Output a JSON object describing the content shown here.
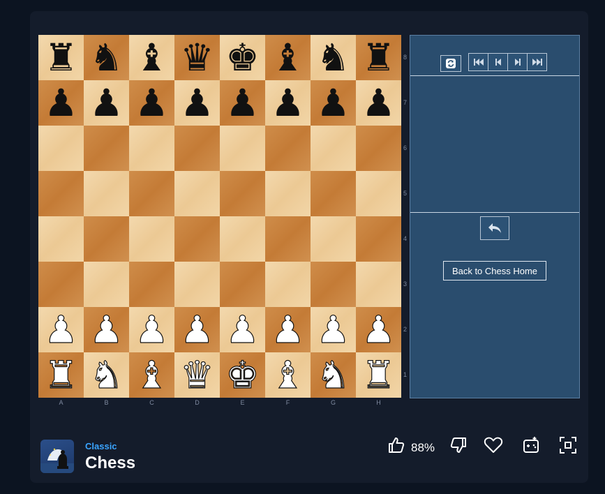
{
  "board": {
    "rows": [
      [
        {
          "p": "♜",
          "c": "black"
        },
        {
          "p": "♞",
          "c": "black"
        },
        {
          "p": "♝",
          "c": "black"
        },
        {
          "p": "♛",
          "c": "black"
        },
        {
          "p": "♚",
          "c": "black"
        },
        {
          "p": "♝",
          "c": "black"
        },
        {
          "p": "♞",
          "c": "black"
        },
        {
          "p": "♜",
          "c": "black"
        }
      ],
      [
        {
          "p": "♟",
          "c": "black"
        },
        {
          "p": "♟",
          "c": "black"
        },
        {
          "p": "♟",
          "c": "black"
        },
        {
          "p": "♟",
          "c": "black"
        },
        {
          "p": "♟",
          "c": "black"
        },
        {
          "p": "♟",
          "c": "black"
        },
        {
          "p": "♟",
          "c": "black"
        },
        {
          "p": "♟",
          "c": "black"
        }
      ],
      [
        {
          "p": "",
          "c": ""
        },
        {
          "p": "",
          "c": ""
        },
        {
          "p": "",
          "c": ""
        },
        {
          "p": "",
          "c": ""
        },
        {
          "p": "",
          "c": ""
        },
        {
          "p": "",
          "c": ""
        },
        {
          "p": "",
          "c": ""
        },
        {
          "p": "",
          "c": ""
        }
      ],
      [
        {
          "p": "",
          "c": ""
        },
        {
          "p": "",
          "c": ""
        },
        {
          "p": "",
          "c": ""
        },
        {
          "p": "",
          "c": ""
        },
        {
          "p": "",
          "c": ""
        },
        {
          "p": "",
          "c": ""
        },
        {
          "p": "",
          "c": ""
        },
        {
          "p": "",
          "c": ""
        }
      ],
      [
        {
          "p": "",
          "c": ""
        },
        {
          "p": "",
          "c": ""
        },
        {
          "p": "",
          "c": ""
        },
        {
          "p": "",
          "c": ""
        },
        {
          "p": "",
          "c": ""
        },
        {
          "p": "",
          "c": ""
        },
        {
          "p": "",
          "c": ""
        },
        {
          "p": "",
          "c": ""
        }
      ],
      [
        {
          "p": "",
          "c": ""
        },
        {
          "p": "",
          "c": ""
        },
        {
          "p": "",
          "c": ""
        },
        {
          "p": "",
          "c": ""
        },
        {
          "p": "",
          "c": ""
        },
        {
          "p": "",
          "c": ""
        },
        {
          "p": "",
          "c": ""
        },
        {
          "p": "",
          "c": ""
        }
      ],
      [
        {
          "p": "♟",
          "c": "white"
        },
        {
          "p": "♟",
          "c": "white"
        },
        {
          "p": "♟",
          "c": "white"
        },
        {
          "p": "♟",
          "c": "white"
        },
        {
          "p": "♟",
          "c": "white"
        },
        {
          "p": "♟",
          "c": "white"
        },
        {
          "p": "♟",
          "c": "white"
        },
        {
          "p": "♟",
          "c": "white"
        }
      ],
      [
        {
          "p": "♜",
          "c": "white"
        },
        {
          "p": "♞",
          "c": "white"
        },
        {
          "p": "♝",
          "c": "white"
        },
        {
          "p": "♛",
          "c": "white"
        },
        {
          "p": "♚",
          "c": "white"
        },
        {
          "p": "♝",
          "c": "white"
        },
        {
          "p": "♞",
          "c": "white"
        },
        {
          "p": "♜",
          "c": "white"
        }
      ]
    ],
    "ranks": [
      "8",
      "7",
      "6",
      "5",
      "4",
      "3",
      "2",
      "1"
    ],
    "files": [
      "A",
      "B",
      "C",
      "D",
      "E",
      "F",
      "G",
      "H"
    ]
  },
  "panel": {
    "flip_icon": "flip-board-icon",
    "nav_icons": [
      "first-move-icon",
      "prev-move-icon",
      "next-move-icon",
      "last-move-icon"
    ],
    "undo_icon": "undo-icon",
    "home_label": "Back to Chess Home"
  },
  "footer": {
    "category": "Classic",
    "title": "Chess",
    "like_pct": "88%",
    "icons": [
      "thumbs-up-icon",
      "thumbs-down-icon",
      "heart-icon",
      "add-to-collection-icon",
      "fullscreen-icon"
    ],
    "accent": "#3aa4ff"
  }
}
